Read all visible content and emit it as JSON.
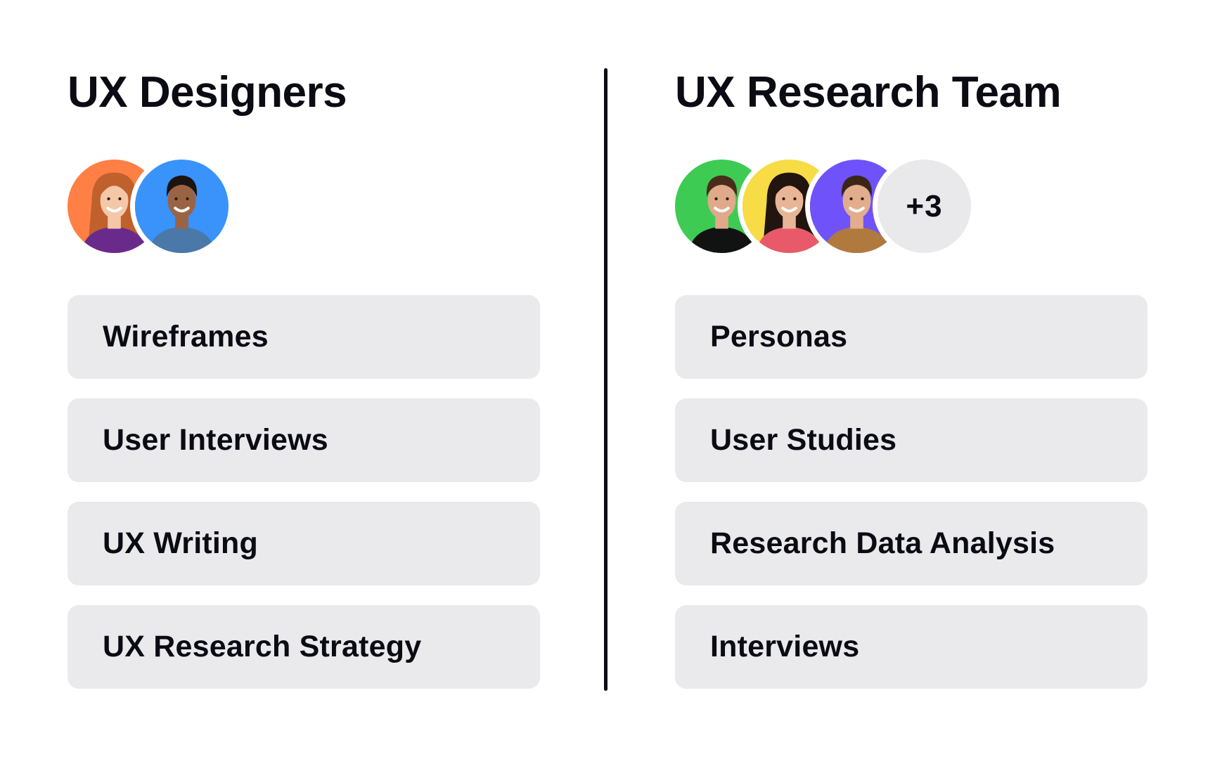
{
  "teams": [
    {
      "title": "UX Designers",
      "avatars": [
        {
          "name": "avatar-woman-red-hair",
          "bg": "#ff7f45",
          "skin": "#f3c7a8",
          "hair": "#c0602c",
          "shirt": "#6a2a8c",
          "hair_style": "long"
        },
        {
          "name": "avatar-man-curly-hair",
          "bg": "#3993fa",
          "skin": "#9a6344",
          "hair": "#1b1411",
          "shirt": "#4a78a8",
          "hair_style": "short"
        }
      ],
      "more_count": null,
      "skills": [
        "Wireframes",
        "User Interviews",
        "UX Writing",
        "UX Research Strategy"
      ]
    },
    {
      "title": "UX Research Team",
      "avatars": [
        {
          "name": "avatar-man-turtleneck",
          "bg": "#3ecb54",
          "skin": "#e0a98a",
          "hair": "#4a2c1c",
          "shirt": "#121212",
          "hair_style": "short"
        },
        {
          "name": "avatar-woman-dark-hair",
          "bg": "#f7dc46",
          "skin": "#e8b596",
          "hair": "#22140f",
          "shirt": "#e85a6a",
          "hair_style": "long"
        },
        {
          "name": "avatar-man-beard",
          "bg": "#7052fb",
          "skin": "#e1ad8c",
          "hair": "#3a2618",
          "shirt": "#b07a3e",
          "hair_style": "short"
        }
      ],
      "more_count": "+3",
      "skills": [
        "Personas",
        "User Studies",
        "Research Data Analysis",
        "Interviews"
      ]
    }
  ],
  "colors": {
    "card_bg": "#eaeaec",
    "text": "#0b0b14",
    "divider": "#0b0b14",
    "more_bg": "#e9e9eb"
  }
}
